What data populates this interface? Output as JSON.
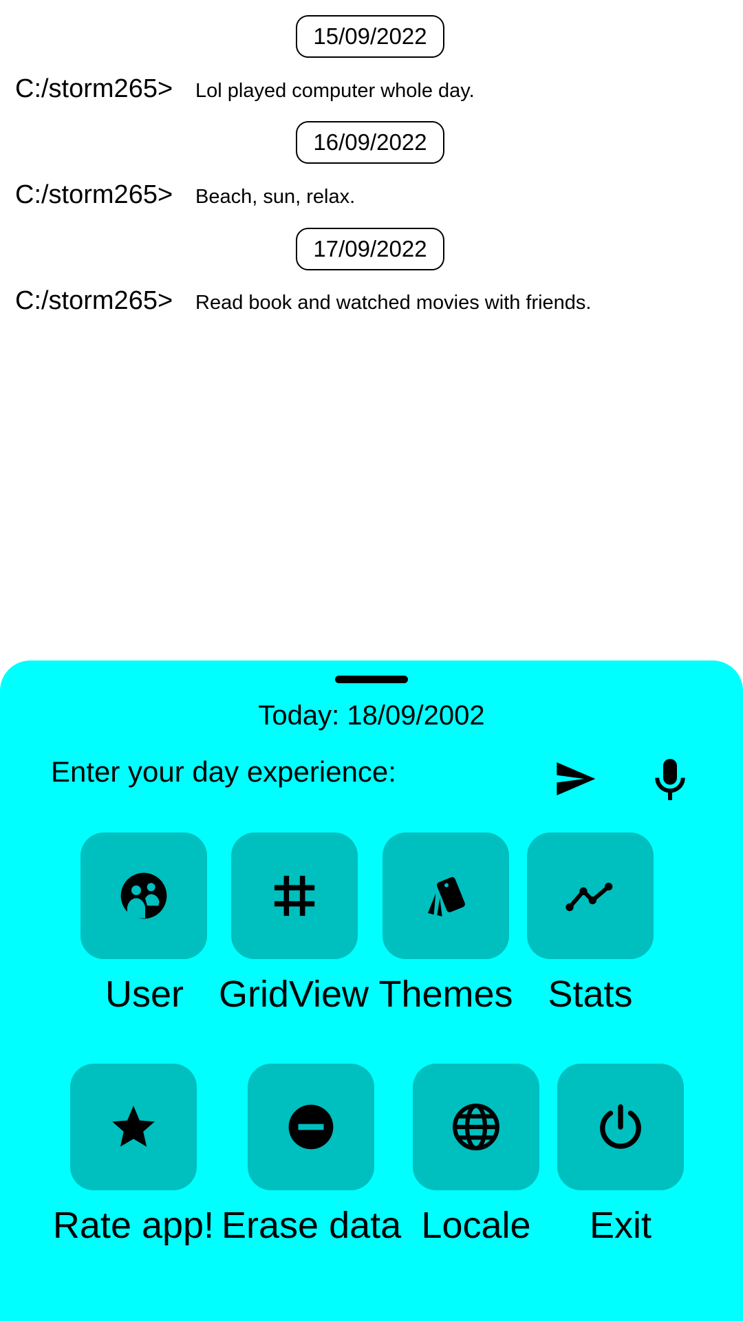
{
  "journal": {
    "prompt": "C:/storm265>",
    "entries": [
      {
        "date": "15/09/2022",
        "text": "Lol played computer whole day."
      },
      {
        "date": "16/09/2022",
        "text": "Beach, sun, relax."
      },
      {
        "date": "17/09/2022",
        "text": "Read book and watched movies with friends."
      }
    ]
  },
  "sheet": {
    "today_label": "Today:",
    "today_date": "18/09/2002",
    "input_placeholder": "Enter your day experience:",
    "send_icon": "send-icon",
    "mic_icon": "microphone-icon",
    "colors": {
      "background": "#00ffff",
      "tile": "#00bfbf"
    },
    "menu": [
      {
        "label": "User",
        "icon": "user-group-icon"
      },
      {
        "label": "GridView",
        "icon": "grid-icon"
      },
      {
        "label": "Themes",
        "icon": "cards-icon"
      },
      {
        "label": "Stats",
        "icon": "line-chart-icon"
      },
      {
        "label": "Rate app!",
        "icon": "star-icon"
      },
      {
        "label": "Erase data",
        "icon": "remove-circle-icon"
      },
      {
        "label": "Locale",
        "icon": "globe-icon"
      },
      {
        "label": "Exit",
        "icon": "power-icon"
      }
    ]
  }
}
